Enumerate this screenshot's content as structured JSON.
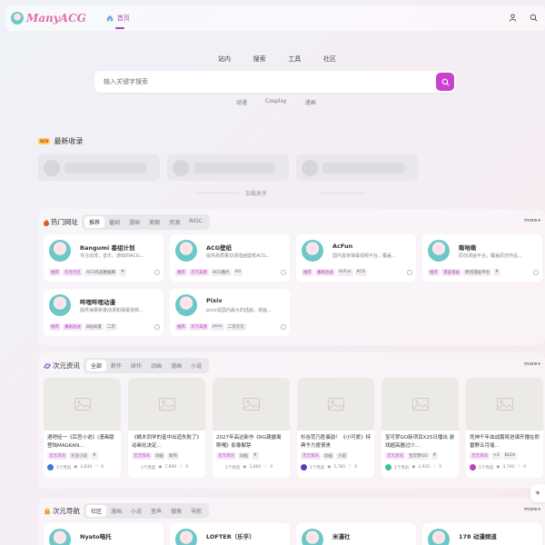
{
  "header": {
    "logo_text": "ManyACG",
    "nav_home": "首页"
  },
  "search": {
    "tabs": [
      "站内",
      "搜索",
      "工具",
      "社区"
    ],
    "placeholder": "输入关键字搜索",
    "hot_tags": [
      "动漫",
      "Cosplay",
      "漫画"
    ]
  },
  "new_section": {
    "badge": "NEW",
    "title": "最新收录",
    "load_more": "加载更多"
  },
  "hot_sites": {
    "title": "热门网址",
    "more": "more+",
    "tabs": [
      "推荐",
      "番剧",
      "漫画",
      "美图",
      "资源",
      "AIGC"
    ],
    "items": [
      {
        "name": "Bangumi 番组计划",
        "desc": "专注动漫，音乐，游戏的ACG...",
        "tags": [
          "推荐",
          "综合社区",
          "ACG作品数据库",
          "#"
        ]
      },
      {
        "name": "ACG壁纸",
        "desc": "提供高质量动漫插画壁纸ACG...",
        "tags": [
          "推荐",
          "次元美图",
          "ACG图片",
          "AO"
        ]
      },
      {
        "name": "AcFun",
        "desc": "国内首家弹幕视频平台，覆盖...",
        "tags": [
          "推荐",
          "番剧放送",
          "AcFun",
          "ACG"
        ]
      },
      {
        "name": "嘶哈嘶",
        "desc": "原创漫画平台，覆盖原创作品...",
        "tags": [
          "推荐",
          "漫画漫画",
          "原创漫画平台",
          "#"
        ]
      },
      {
        "name": "哔哩哔哩动漫",
        "desc": "提供海量新番动漫和弹幕视频...",
        "tags": [
          "推荐",
          "番剧放送",
          "B站动漫",
          "二次"
        ]
      },
      {
        "name": "Pixiv",
        "desc": "pixiv是国内最大的插画，漫画...",
        "tags": [
          "推荐",
          "次元美图",
          "pixiv",
          "二次元写"
        ]
      }
    ]
  },
  "news": {
    "title": "次元资讯",
    "more": "more+",
    "tabs": [
      "全部",
      "新作",
      "续作",
      "动画",
      "漫画",
      "小说"
    ],
    "items": [
      {
        "title": "酒吧经一《后宫小说》(漫画版登陆MAGKAN...",
        "tags": [
          "次元资讯",
          "东宝小说",
          "#"
        ],
        "time": "1个月前",
        "views": "4,830",
        "likes": "0",
        "ucolor": "#3a7bd5"
      },
      {
        "title": "《橘木同学的富中出道失败了》动画化决定...",
        "tags": [
          "次元资讯",
          "动画",
          "新作"
        ],
        "time": "1个月前",
        "views": "7,890",
        "likes": "0",
        "ucolor": "#ffffff"
      },
      {
        "title": "2027年高达新作《RG葫露寓斯嘎》影像解禁",
        "tags": [
          "次元资讯",
          "动画",
          "#"
        ],
        "time": "1个月前",
        "views": "3,860",
        "likes": "0",
        "ucolor": "#ffffff"
      },
      {
        "title": "杉谷范乃胜奏韵！《小可爱》特典予力度很贵",
        "tags": [
          "次元资讯",
          "动画",
          "小说"
        ],
        "time": "1个月前",
        "views": "5,785",
        "likes": "0",
        "ucolor": "#5a3ac0"
      },
      {
        "title": "宝可梦GO新项目X25日播出 游戏超高器过少...",
        "tags": [
          "次元资讯",
          "宝可梦GO",
          "#"
        ],
        "time": "1个月前",
        "views": "2,935",
        "likes": "0",
        "ucolor": "#3ac0a0"
      },
      {
        "title": "死神千年血战篇将进课开播在即 雷野五月瑶...",
        "tags": [
          "次元资讯",
          "+3",
          "BLEA"
        ],
        "time": "1个月前",
        "views": "4,700",
        "likes": "0",
        "ucolor": "#c040c0"
      }
    ]
  },
  "nav_section": {
    "title": "次元导航",
    "more": "more+",
    "tabs": [
      "社区",
      "漫画",
      "小说",
      "音声",
      "搜索",
      "导航"
    ],
    "items": [
      {
        "name": "Nyato喵托"
      },
      {
        "name": "LOFTER（乐乎）"
      },
      {
        "name": "米漫社"
      },
      {
        "name": "178 动漫频道"
      }
    ]
  }
}
